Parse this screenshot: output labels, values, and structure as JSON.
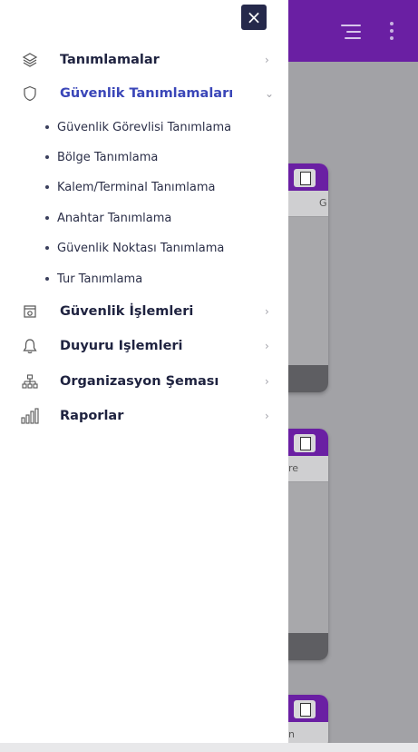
{
  "close_label": "×",
  "menu": [
    {
      "label": "Tanımlamalar",
      "icon": "layers-icon",
      "expanded": false
    },
    {
      "label": "Güvenlik Tanımlamaları",
      "icon": "shield-icon",
      "expanded": true,
      "children": [
        "Güvenlik Görevlisi Tanımlama",
        "Bölge Tanımlama",
        "Kalem/Terminal Tanımlama",
        "Anahtar Tanımlama",
        "Güvenlik Noktası Tanımlama",
        "Tur Tanımlama"
      ]
    },
    {
      "label": "Güvenlik İşlemleri",
      "icon": "safe-icon",
      "expanded": false
    },
    {
      "label": "Duyuru Işlemleri",
      "icon": "bell-icon",
      "expanded": false
    },
    {
      "label": "Organizasyon Şeması",
      "icon": "org-chart-icon",
      "expanded": false
    },
    {
      "label": "Raporlar",
      "icon": "bar-chart-icon",
      "expanded": false
    }
  ],
  "background": {
    "card1_col": "G",
    "card2_col": "re",
    "card3_col": "n"
  },
  "colors": {
    "header": "#6a1fa3",
    "close_button": "#25294b",
    "active_text": "#3a46b8"
  }
}
